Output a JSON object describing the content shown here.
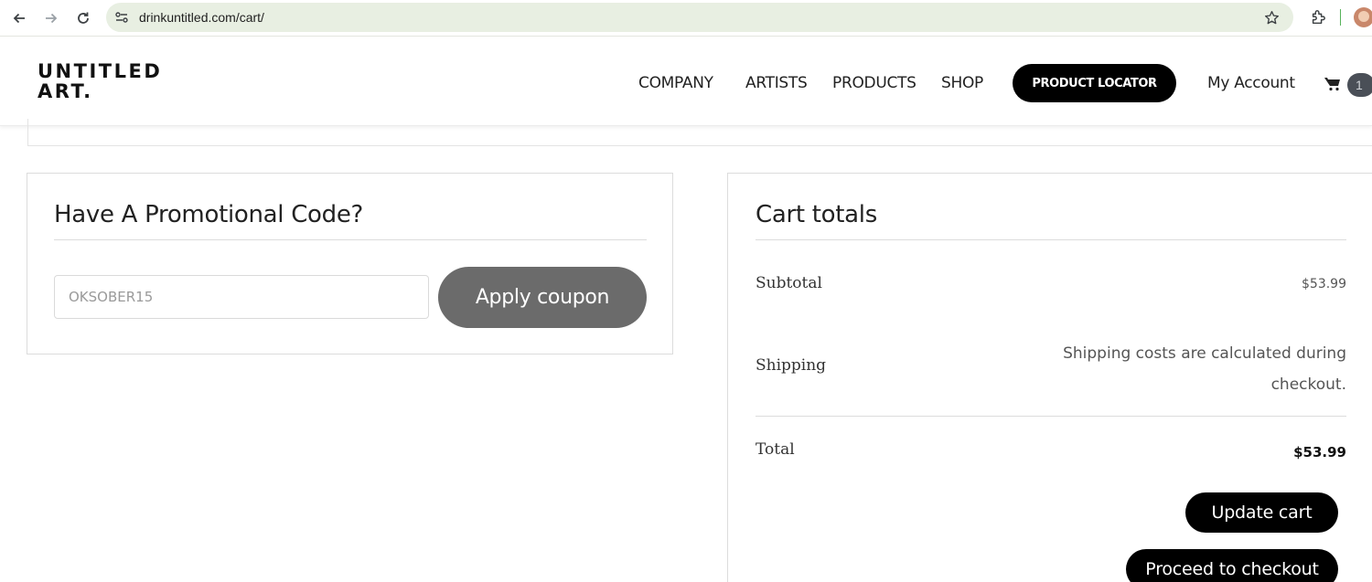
{
  "browser": {
    "url": "drinkuntitled.com/cart/"
  },
  "header": {
    "logo_line1": "UNTITLED",
    "logo_line2": "ART.",
    "nav": [
      "COMPANY",
      "ARTISTS",
      "PRODUCTS",
      "SHOP"
    ],
    "locator_label": "PRODUCT LOCATOR",
    "account_label": "My Account",
    "cart_count": "1"
  },
  "promo": {
    "title": "Have A Promotional Code?",
    "coupon_value": "OKSOBER15",
    "apply_label": "Apply coupon"
  },
  "totals": {
    "title": "Cart totals",
    "subtotal_label": "Subtotal",
    "subtotal_value": "$53.99",
    "shipping_label": "Shipping",
    "shipping_value": "Shipping costs are calculated during checkout.",
    "total_label": "Total",
    "total_value": "$53.99",
    "update_label": "Update cart",
    "checkout_label": "Proceed to checkout"
  },
  "colors": {
    "accent": "#000000",
    "apply_button": "#6b6b6b",
    "url_bar": "#e8efe2"
  }
}
